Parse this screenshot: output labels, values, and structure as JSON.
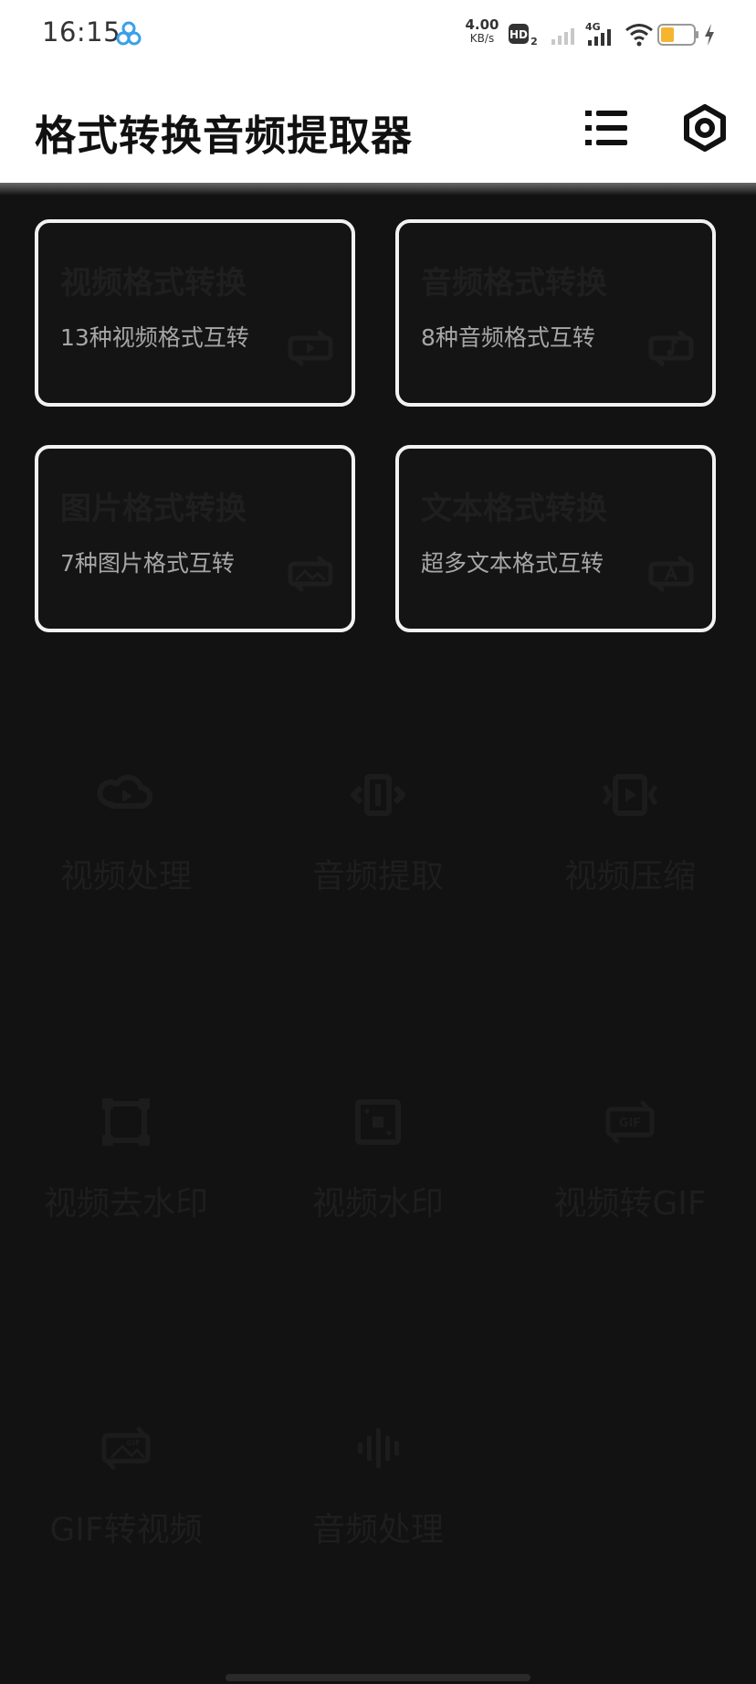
{
  "status_bar": {
    "time": "16:15",
    "speed_value": "4.00",
    "speed_unit": "KB/s",
    "hd_label": "HD",
    "hd_sub": "2",
    "network": "4G",
    "icons": [
      "app-badge-icon",
      "hd-icon",
      "signal-weak-icon",
      "signal-4g-icon",
      "wifi-icon",
      "battery-icon",
      "charging-icon"
    ]
  },
  "header": {
    "title": "格式转换音频提取器",
    "menu_icon": "list-icon",
    "settings_icon": "settings-icon"
  },
  "cards": [
    {
      "title": "视频格式转换",
      "subtitle": "13种视频格式互转",
      "icon": "video-convert-icon"
    },
    {
      "title": "音频格式转换",
      "subtitle": "8种音频格式互转",
      "icon": "audio-convert-icon"
    },
    {
      "title": "图片格式转换",
      "subtitle": "7种图片格式互转",
      "icon": "image-convert-icon"
    },
    {
      "title": "文本格式转换",
      "subtitle": "超多文本格式互转",
      "icon": "text-convert-icon"
    }
  ],
  "tools": [
    {
      "label": "视频处理",
      "icon": "video-process-icon"
    },
    {
      "label": "音频提取",
      "icon": "audio-extract-icon"
    },
    {
      "label": "视频压缩",
      "icon": "video-compress-icon"
    },
    {
      "label": "视频去水印",
      "icon": "remove-watermark-icon"
    },
    {
      "label": "视频水印",
      "icon": "add-watermark-icon"
    },
    {
      "label": "视频转GIF",
      "icon": "video-to-gif-icon"
    },
    {
      "label": "GIF转视频",
      "icon": "gif-to-video-icon"
    },
    {
      "label": "音频处理",
      "icon": "audio-process-icon"
    }
  ],
  "colors": {
    "background": "#121212",
    "header_bg": "#ffffff",
    "card_border": "#f2f2f2",
    "subtitle": "#a6a6a6",
    "battery": "#f5b530"
  }
}
